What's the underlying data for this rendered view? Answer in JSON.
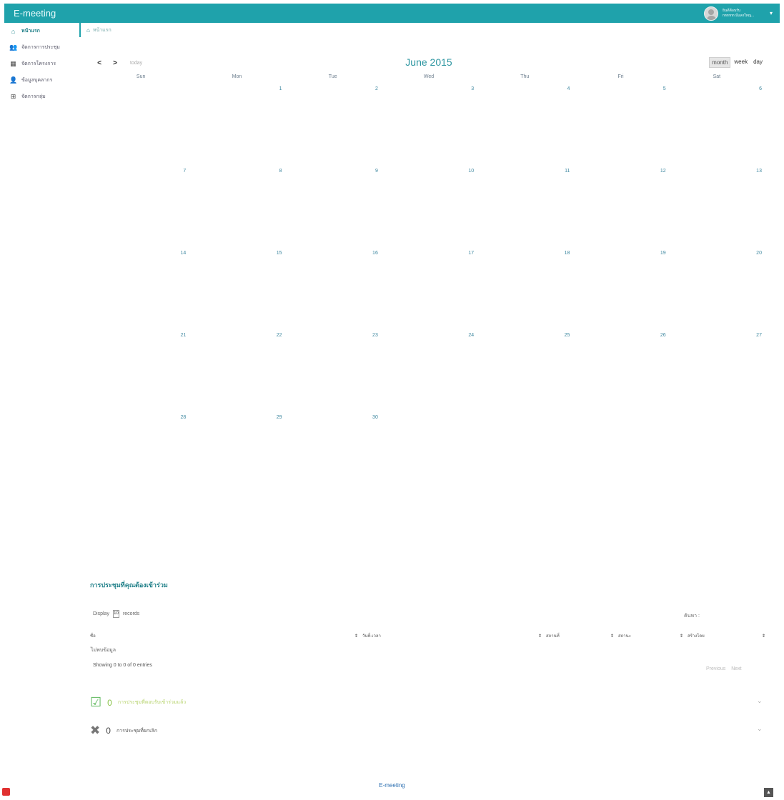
{
  "app": {
    "title": "E-meeting"
  },
  "user": {
    "line1": "ยินดีต้อนรับ",
    "line2": "nnnnnn มีแสงใหญ...",
    "avatar_icon": "user-avatar"
  },
  "sidebar": {
    "items": [
      {
        "label": "หน้าแรก",
        "icon": "home-icon",
        "active": true
      },
      {
        "label": "จัดการการประชุม",
        "icon": "users-icon",
        "active": false
      },
      {
        "label": "จัดการโครงการ",
        "icon": "table-icon",
        "active": false
      },
      {
        "label": "ข้อมูลบุคลากร",
        "icon": "user-icon",
        "active": false
      },
      {
        "label": "จัดการกลุ่ม",
        "icon": "plus-square-icon",
        "active": false
      }
    ]
  },
  "breadcrumb": {
    "label": "หน้าแรก"
  },
  "calendar": {
    "title": "June 2015",
    "prev_label": "<",
    "next_label": ">",
    "today_label": "today",
    "views": [
      "month",
      "week",
      "day"
    ],
    "active_view": "month",
    "days_of_week": [
      "Sun",
      "Mon",
      "Tue",
      "Wed",
      "Thu",
      "Fri",
      "Sat"
    ],
    "weeks": [
      [
        "",
        "1",
        "2",
        "3",
        "4",
        "5",
        "6"
      ],
      [
        "7",
        "8",
        "9",
        "10",
        "11",
        "12",
        "13"
      ],
      [
        "14",
        "15",
        "16",
        "17",
        "18",
        "19",
        "20"
      ],
      [
        "21",
        "22",
        "23",
        "24",
        "25",
        "26",
        "27"
      ],
      [
        "28",
        "29",
        "30",
        "",
        "",
        "",
        ""
      ]
    ]
  },
  "meetings": {
    "title": "การประชุมที่คุณต้องเข้าร่วม",
    "display_label": "Display",
    "length_value": "10",
    "records_label": "records",
    "search_label": "ค้นหา :",
    "columns": [
      "ชื่อ",
      "วันที่-เวลา",
      "สถานที่",
      "สถานะ",
      "สร้างโดย"
    ],
    "empty_text": "ไม่พบข้อมูล",
    "info": "Showing 0 to 0 of 0 entries",
    "prev_label": "Previous",
    "next_label": "Next"
  },
  "stats": {
    "confirmed": {
      "count": "0",
      "label": "การประชุมที่ตอบรับเข้าร่วมแล้ว",
      "icon": "check-square-icon"
    },
    "cancelled": {
      "count": "0",
      "label": "การประชุมที่ยกเลิก",
      "icon": "times-icon"
    }
  },
  "footer": {
    "text": "E-meeting"
  },
  "colors": {
    "brand": "#1fa2ab",
    "link": "#2d96a1"
  }
}
